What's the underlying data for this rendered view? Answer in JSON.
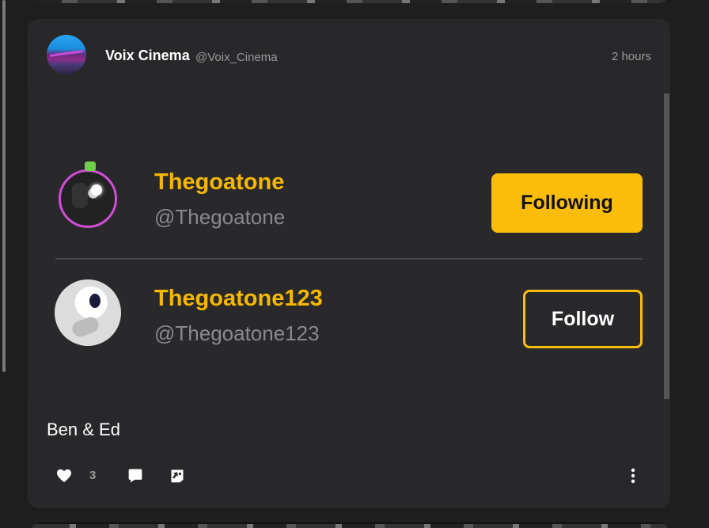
{
  "post": {
    "author_name": "Voix Cinema",
    "author_handle": "@Voix_Cinema",
    "timestamp": "2 hours",
    "body_text": "Ben & Ed",
    "like_count": "3"
  },
  "embedded_list": {
    "users": [
      {
        "name": "Thegoatone",
        "handle": "@Thegoatone",
        "button_label": "Following"
      },
      {
        "name": "Thegoatone123",
        "handle": "@Thegoatone123",
        "button_label": "Follow"
      }
    ]
  },
  "actions": {
    "like_icon": "heart-icon",
    "comment_icon": "comment-icon",
    "reblog_icon": "repost-icon",
    "more_icon": "more-vertical-icon"
  },
  "colors": {
    "accent": "#fbbd0b",
    "card_bg": "#28282a",
    "page_bg": "#1e1e1f",
    "text_primary": "#ffffff",
    "text_muted": "#9a9a9a"
  }
}
